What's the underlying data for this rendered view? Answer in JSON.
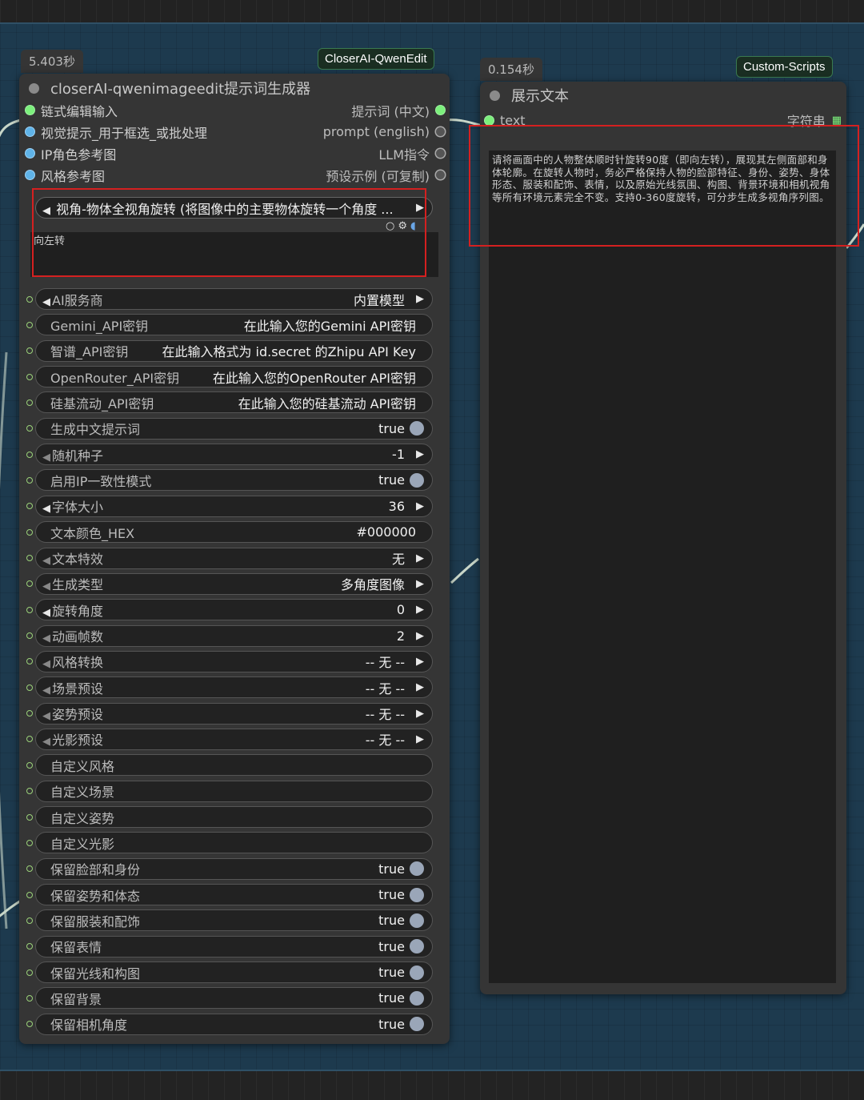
{
  "left_node": {
    "exec_time": "5.403秒",
    "badge": "CloserAI-QwenEdit",
    "title": "closerAI-qwenimageedit提示词生成器",
    "inputs": [
      {
        "label": "链式编辑输入",
        "dot": "green"
      },
      {
        "label": "视觉提示_用于框选_或批处理",
        "dot": "blue"
      },
      {
        "label": "IP角色参考图",
        "dot": "blue"
      },
      {
        "label": "风格参考图",
        "dot": "blue"
      }
    ],
    "outputs": [
      {
        "label": "提示词 (中文)",
        "dot": "green"
      },
      {
        "label": "prompt (english)",
        "dot": "grey"
      },
      {
        "label": "LLM指令",
        "dot": "grey"
      },
      {
        "label": "预设示例 (可复制)",
        "dot": "grey"
      }
    ],
    "preset_combo": "视角-物体全视角旋转 (将图像中的主要物体旋转一个角度 ...",
    "preset_text": "向左转",
    "widgets": [
      {
        "name": "AI服务商",
        "value": "内置模型",
        "kind": "combo"
      },
      {
        "name": "Gemini_API密钥",
        "value": "在此输入您的Gemini API密钥",
        "kind": "text"
      },
      {
        "name": "智谱_API密钥",
        "value": "在此输入格式为 id.secret 的Zhipu API Key",
        "kind": "text"
      },
      {
        "name": "OpenRouter_API密钥",
        "value": "在此输入您的OpenRouter API密钥",
        "kind": "text"
      },
      {
        "name": "硅基流动_API密钥",
        "value": "在此输入您的硅基流动 API密钥",
        "kind": "text"
      },
      {
        "name": "生成中文提示词",
        "value": "true",
        "kind": "toggle"
      },
      {
        "name": "随机种子",
        "value": "-1",
        "kind": "number"
      },
      {
        "name": "启用IP一致性模式",
        "value": "true",
        "kind": "toggle"
      },
      {
        "name": "字体大小",
        "value": "36",
        "kind": "number"
      },
      {
        "name": "文本颜色_HEX",
        "value": "#000000",
        "kind": "text"
      },
      {
        "name": "文本特效",
        "value": "无",
        "kind": "combo"
      },
      {
        "name": "生成类型",
        "value": "多角度图像",
        "kind": "combo"
      },
      {
        "name": "旋转角度",
        "value": "0",
        "kind": "number"
      },
      {
        "name": "动画帧数",
        "value": "2",
        "kind": "number"
      },
      {
        "name": "风格转换",
        "value": "-- 无 --",
        "kind": "combo"
      },
      {
        "name": "场景预设",
        "value": "-- 无 --",
        "kind": "combo"
      },
      {
        "name": "姿势预设",
        "value": "-- 无 --",
        "kind": "combo"
      },
      {
        "name": "光影预设",
        "value": "-- 无 --",
        "kind": "combo"
      },
      {
        "name": "自定义风格",
        "value": "",
        "kind": "text"
      },
      {
        "name": "自定义场景",
        "value": "",
        "kind": "text"
      },
      {
        "name": "自定义姿势",
        "value": "",
        "kind": "text"
      },
      {
        "name": "自定义光影",
        "value": "",
        "kind": "text"
      },
      {
        "name": "保留脸部和身份",
        "value": "true",
        "kind": "toggle"
      },
      {
        "name": "保留姿势和体态",
        "value": "true",
        "kind": "toggle"
      },
      {
        "name": "保留服装和配饰",
        "value": "true",
        "kind": "toggle"
      },
      {
        "name": "保留表情",
        "value": "true",
        "kind": "toggle"
      },
      {
        "name": "保留光线和构图",
        "value": "true",
        "kind": "toggle"
      },
      {
        "name": "保留背景",
        "value": "true",
        "kind": "toggle"
      },
      {
        "name": "保留相机角度",
        "value": "true",
        "kind": "toggle"
      }
    ]
  },
  "right_node": {
    "exec_time": "0.154秒",
    "badge": "Custom-Scripts",
    "title": "展示文本",
    "input_label": "text",
    "output_label": "字符串",
    "text": "请将画面中的人物整体顺时针旋转90度（即向左转），展现其左侧面部和身体轮廓。在旋转人物时，务必严格保持人物的脸部特征、身份、姿势、身体形态、服装和配饰、表情，以及原始光线氛围、构图、背景环境和相机视角等所有环境元素完全不变。支持0-360度旋转，可分步生成多视角序列图。"
  },
  "colors": {
    "canvas": "#1d3a4e",
    "node": "#353535",
    "highlight": "#d42020",
    "link": "#c8d6c8"
  }
}
